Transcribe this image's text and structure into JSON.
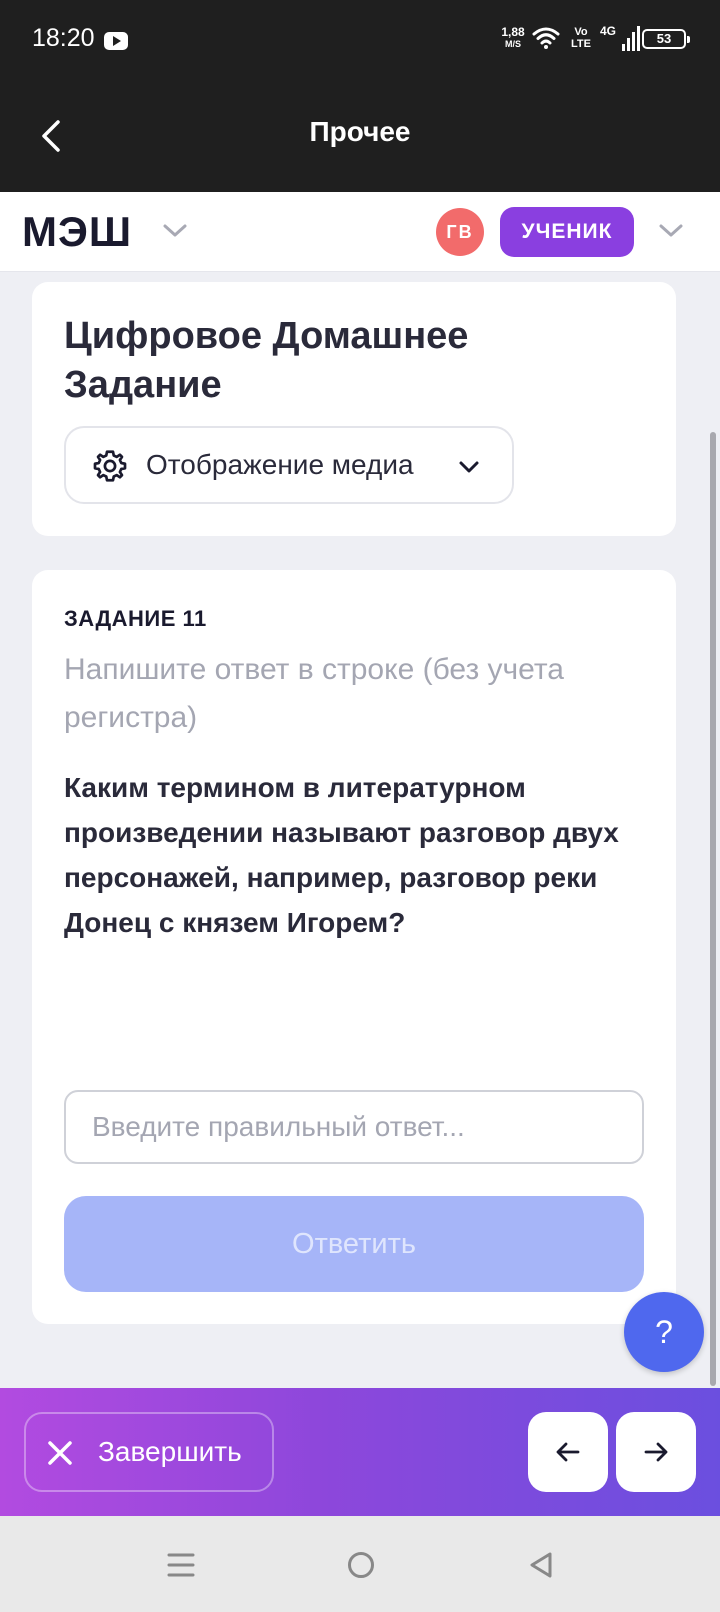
{
  "status_bar": {
    "time": "18:20",
    "net_speed_value": "1,88",
    "net_speed_unit": "M/S",
    "volte_top": "Vo",
    "volte_bottom": "LTE",
    "network": "4G",
    "battery": "53",
    "icons": [
      "youtube-icon",
      "wifi-icon",
      "signal-icon",
      "battery-icon"
    ]
  },
  "app_header": {
    "title": "Прочее",
    "back_icon": "chevron-left-icon"
  },
  "top_bar": {
    "logo": "МЭШ",
    "avatar_initials": "ГВ",
    "role": "УЧЕНИК",
    "avatar_color": "#f26b6b",
    "role_color": "#8a3fe0"
  },
  "title_card": {
    "title": "Цифровое Домашнее Задание",
    "media_toggle_label": "Отображение медиа"
  },
  "task": {
    "number_label": "ЗАДАНИЕ 11",
    "instruction": "Напишите ответ в строке (без учета регистра)",
    "question": "Каким термином в литературном произведении называют разговор двух персонажей, например, разговор реки Донец с князем Игорем?",
    "answer_placeholder": "Введите правильный ответ...",
    "answer_value": "",
    "submit_label": "Ответить"
  },
  "help_button_label": "?",
  "bottom_bar": {
    "finish_label": "Завершить",
    "prev_icon": "arrow-left-icon",
    "next_icon": "arrow-right-icon"
  },
  "colors": {
    "accent": "#4f68ee",
    "submit_disabled": "#a6b5f8",
    "bottom_gradient_start": "#b24be0",
    "bottom_gradient_end": "#6b4fdf"
  }
}
